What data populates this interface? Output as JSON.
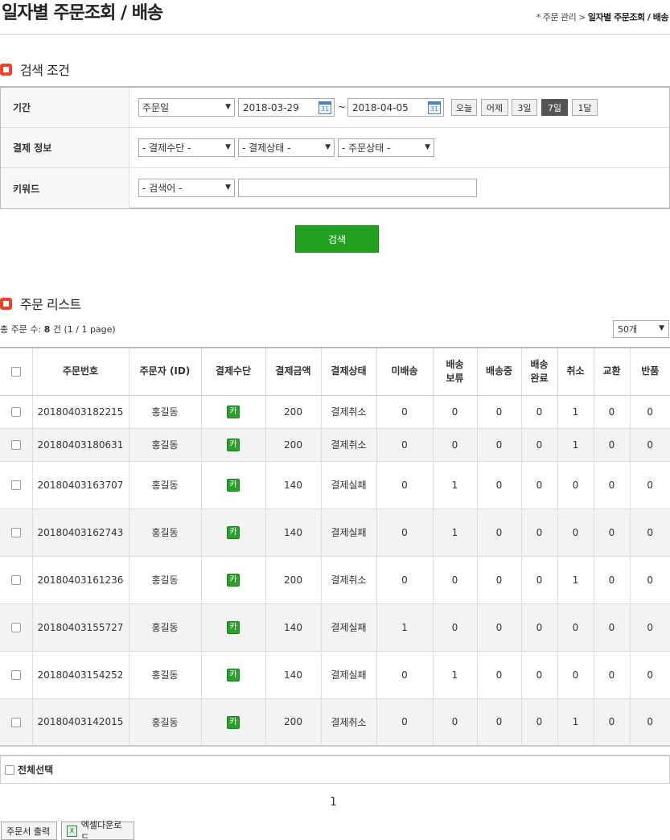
{
  "header": {
    "title": "일자별 주문조회 / 배송",
    "breadcrumb_prefix": "* 주문 관리 >",
    "breadcrumb_current": "일자별 주문조회 / 배송"
  },
  "search_section": {
    "title": "검색 조건",
    "period_label": "기간",
    "date_type": "주문일",
    "date_from": "2018-03-29",
    "tilde": "~",
    "date_to": "2018-04-05",
    "calendar_icon_text": "31",
    "quick_buttons": [
      "오늘",
      "어제",
      "3일",
      "7일",
      "1달"
    ],
    "active_quick_button": "7일",
    "payment_label": "결제 정보",
    "payment_method": "- 결제수단 -",
    "payment_status": "- 결제상태 -",
    "order_status": "- 주문상태 -",
    "keyword_label": "키워드",
    "keyword_type": "- 검색어 -",
    "keyword_value": "",
    "search_button": "검색"
  },
  "list_section": {
    "title": "주문 리스트",
    "total_prefix": "총 주문 수:",
    "total_count": "8",
    "total_suffix": "건 (1 / 1 page)",
    "page_size": "50개",
    "columns": [
      "",
      "주문번호",
      "주문자 (ID)",
      "결제수단",
      "결제금액",
      "결제상태",
      "미배송",
      "배송\n보류",
      "배송중",
      "배송\n완료",
      "취소",
      "교환",
      "반품"
    ],
    "pay_badge_text": "카",
    "rows": [
      {
        "order_no": "20180403182215",
        "customer": "홍길동",
        "amount": "200",
        "status": "결제취소",
        "failed": false,
        "undelivered": "0",
        "hold": "0",
        "shipping": "0",
        "delivered": "0",
        "cancel": "1",
        "exchange": "0",
        "return": "0"
      },
      {
        "order_no": "20180403180631",
        "customer": "홍길동",
        "amount": "200",
        "status": "결제취소",
        "failed": false,
        "undelivered": "0",
        "hold": "0",
        "shipping": "0",
        "delivered": "0",
        "cancel": "1",
        "exchange": "0",
        "return": "0"
      },
      {
        "order_no": "20180403163707",
        "customer": "홍길동",
        "amount": "140",
        "status": "결제실패",
        "failed": true,
        "undelivered": "0",
        "hold": "1",
        "shipping": "0",
        "delivered": "0",
        "cancel": "0",
        "exchange": "0",
        "return": "0"
      },
      {
        "order_no": "20180403162743",
        "customer": "홍길동",
        "amount": "140",
        "status": "결제실패",
        "failed": true,
        "undelivered": "0",
        "hold": "1",
        "shipping": "0",
        "delivered": "0",
        "cancel": "0",
        "exchange": "0",
        "return": "0"
      },
      {
        "order_no": "20180403161236",
        "customer": "홍길동",
        "amount": "200",
        "status": "결제취소",
        "failed": false,
        "undelivered": "0",
        "hold": "0",
        "shipping": "0",
        "delivered": "0",
        "cancel": "1",
        "exchange": "0",
        "return": "0"
      },
      {
        "order_no": "20180403155727",
        "customer": "홍길동",
        "amount": "140",
        "status": "결제실패",
        "failed": true,
        "undelivered": "1",
        "hold": "0",
        "shipping": "0",
        "delivered": "0",
        "cancel": "0",
        "exchange": "0",
        "return": "0"
      },
      {
        "order_no": "20180403154252",
        "customer": "홍길동",
        "amount": "140",
        "status": "결제실패",
        "failed": true,
        "undelivered": "0",
        "hold": "1",
        "shipping": "0",
        "delivered": "0",
        "cancel": "0",
        "exchange": "0",
        "return": "0"
      },
      {
        "order_no": "20180403142015",
        "customer": "홍길동",
        "amount": "200",
        "status": "결제취소",
        "failed": false,
        "undelivered": "0",
        "hold": "0",
        "shipping": "0",
        "delivered": "0",
        "cancel": "1",
        "exchange": "0",
        "return": "0"
      }
    ],
    "select_all_label": "전체선택",
    "current_page": "1",
    "print_button": "주문서 출력",
    "excel_button": "엑셀다운로드",
    "excel_icon_text": "X"
  },
  "colors": {
    "accent_red": "#e8452c",
    "search_green": "#22a022",
    "link_blue": "#2366b8",
    "fail_green": "#1a8a1a"
  }
}
